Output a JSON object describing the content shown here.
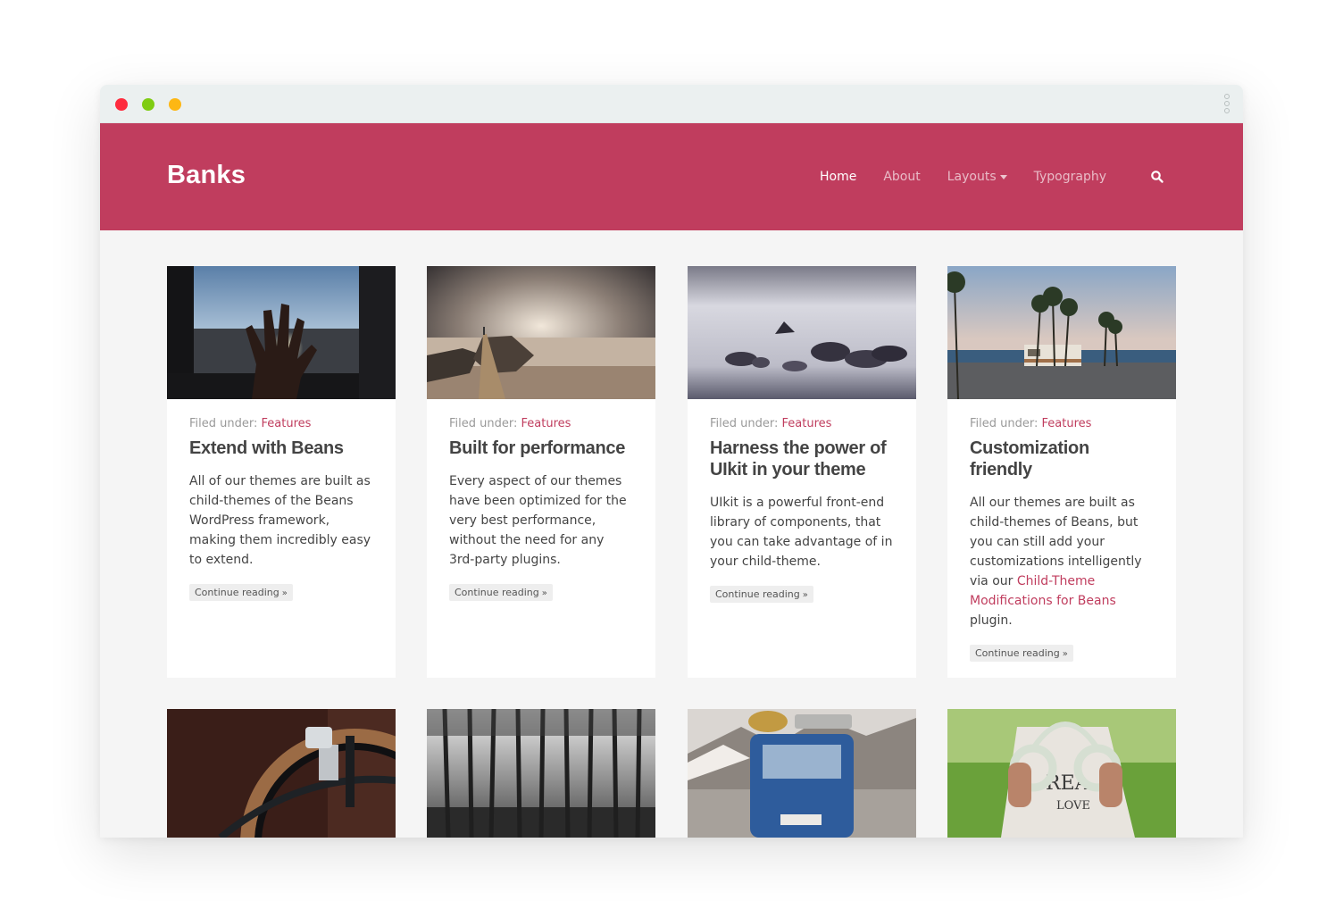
{
  "site": {
    "brand": "Banks",
    "nav": [
      {
        "label": "Home",
        "active": true
      },
      {
        "label": "About",
        "active": false
      },
      {
        "label": "Layouts",
        "active": false
      },
      {
        "label": "Typography",
        "active": false
      }
    ],
    "accent_color": "#c03d5e"
  },
  "posts": [
    {
      "filed_prefix": "Filed under:",
      "category": "Features",
      "title": "Extend with Beans",
      "excerpt": "All of our themes are built as child-themes of the Beans WordPress framework, making them incredibly easy to extend.",
      "more": "Continue reading",
      "image": "hand-against-window-photo"
    },
    {
      "filed_prefix": "Filed under:",
      "category": "Features",
      "title": "Built for performance",
      "excerpt": "Every aspect of our themes have been optimized for the very best performance, without the need for any 3rd-party plugins.",
      "more": "Continue reading",
      "image": "pier-at-sea-photo"
    },
    {
      "filed_prefix": "Filed under:",
      "category": "Features",
      "title_line1": "Harness the power of",
      "title_line2": "UIkit in your theme",
      "excerpt": "UIkit is a powerful front-end library of components, that you can take advantage of in your child-theme.",
      "more": "Continue reading",
      "image": "misty-rocks-photo"
    },
    {
      "filed_prefix": "Filed under:",
      "category": "Features",
      "title": "Customization friendly",
      "excerpt_before": "All our themes are built as child-themes of Beans, but you can still add your customizations intelligently via our",
      "excerpt_link": "Child-Theme Modifications for Beans",
      "excerpt_after": "plugin.",
      "more": "Continue reading",
      "image": "palm-trees-trailer-photo"
    }
  ],
  "second_row_images": [
    "bicycle-wheel-photo",
    "forest-photo",
    "blue-van-photo",
    "headphones-photo"
  ]
}
